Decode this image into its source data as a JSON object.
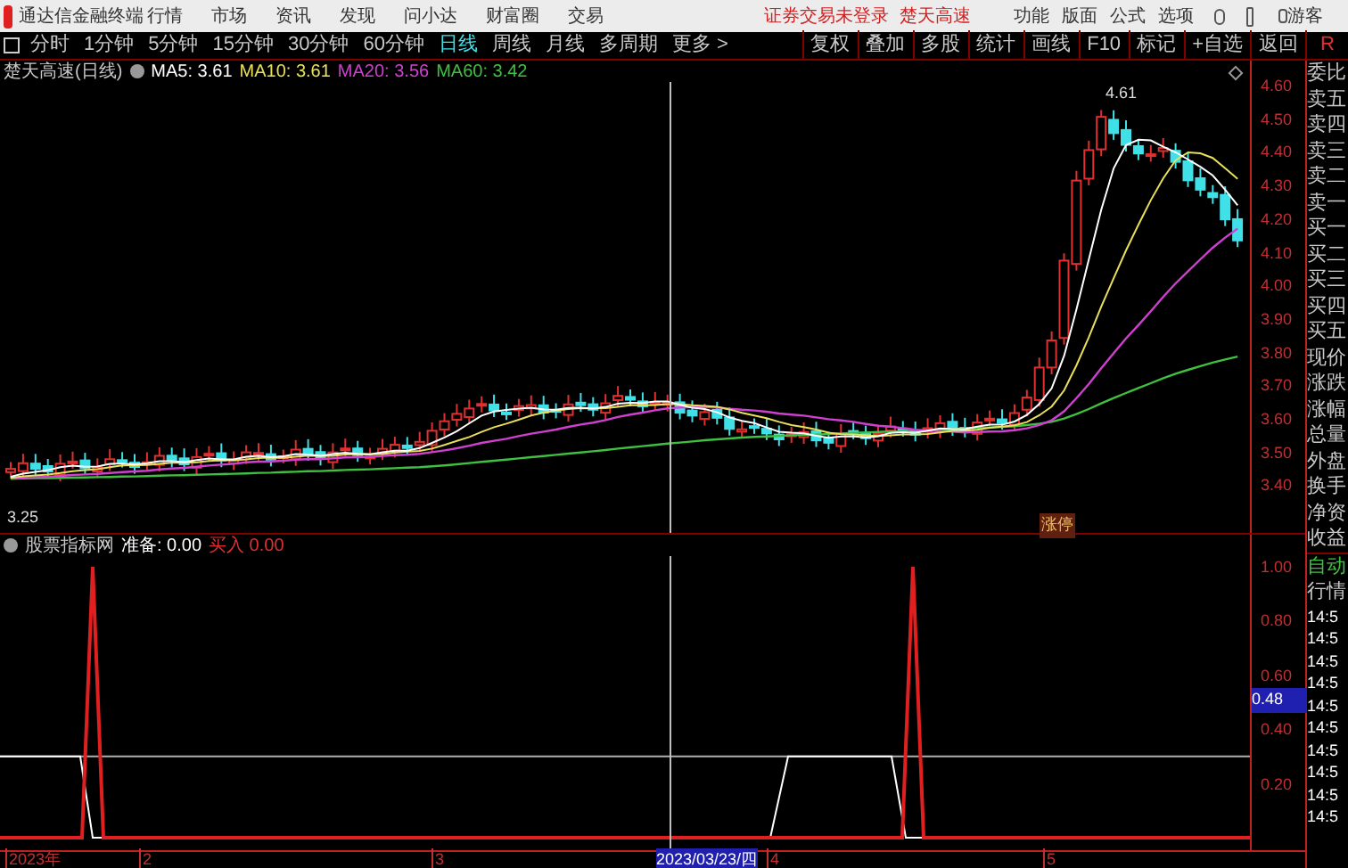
{
  "app_bar": {
    "title": "通达信金融终端",
    "menu": [
      "行情",
      "市场",
      "资讯",
      "发现",
      "问小达",
      "财富圈",
      "交易"
    ],
    "status_texts": [
      "证券交易未登录",
      "楚天高速"
    ],
    "tools": [
      "功能",
      "版面",
      "公式",
      "选项"
    ],
    "user": "游客"
  },
  "periods": [
    {
      "label": "分时",
      "selected": false
    },
    {
      "label": "1分钟",
      "selected": false
    },
    {
      "label": "5分钟",
      "selected": false
    },
    {
      "label": "15分钟",
      "selected": false
    },
    {
      "label": "30分钟",
      "selected": false
    },
    {
      "label": "60分钟",
      "selected": false
    },
    {
      "label": "日线",
      "selected": true
    },
    {
      "label": "周线",
      "selected": false
    },
    {
      "label": "月线",
      "selected": false
    },
    {
      "label": "多周期",
      "selected": false
    },
    {
      "label": "更多 >",
      "selected": false
    }
  ],
  "actions": [
    "复权",
    "叠加",
    "多股",
    "统计",
    "画线",
    "F10",
    "标记",
    "+自选",
    "返回"
  ],
  "corner_mark": "R",
  "price_chart": {
    "stock": "楚天高速(日线)",
    "ma": [
      {
        "label": "MA5: 3.61",
        "color": "#ffffff"
      },
      {
        "label": "MA10: 3.61",
        "color": "#e8e05a"
      },
      {
        "label": "MA20: 3.56",
        "color": "#d040d0"
      },
      {
        "label": "MA60: 3.42",
        "color": "#40c040"
      }
    ],
    "high_label": "4.61",
    "low_label": "3.25",
    "tag": "涨停",
    "axis": [
      "4.60",
      "4.50",
      "4.40",
      "4.30",
      "4.20",
      "4.10",
      "4.00",
      "3.90",
      "3.80",
      "3.70",
      "3.60",
      "3.50",
      "3.40"
    ]
  },
  "indicator": {
    "name": "股票指标网",
    "values": [
      {
        "label": "准备: 0.00",
        "color": "#ffffff"
      },
      {
        "label": "买入 0.00",
        "color": "#e03030"
      }
    ],
    "axis": [
      "1.00",
      "0.80",
      "0.60",
      "0.40",
      "0.20"
    ],
    "cursor_value": "0.48"
  },
  "x_axis": {
    "labels": [
      "2023年",
      "2",
      "3",
      "4",
      "5"
    ],
    "cursor_date": "2023/03/23/四"
  },
  "quote_panel": {
    "fields": [
      "委比",
      "卖五",
      "卖四",
      "卖三",
      "卖二",
      "卖一",
      "买一",
      "买二",
      "买三",
      "买四",
      "买五",
      "现价",
      "涨跌",
      "涨幅",
      "总量",
      "外盘",
      "换手",
      "净资",
      "收益"
    ],
    "auto": "自动",
    "quote": "行情",
    "times": [
      "14:5",
      "14:5",
      "14:5",
      "14:5",
      "14:5",
      "14:5",
      "14:5",
      "14:5",
      "14:5",
      "14:5"
    ]
  }
}
